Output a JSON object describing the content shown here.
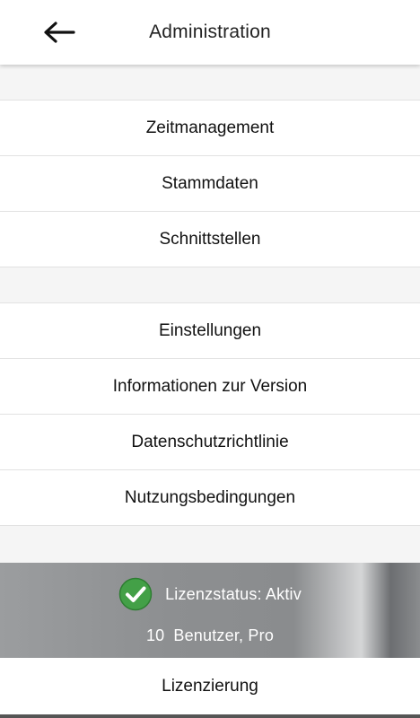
{
  "header": {
    "title": "Administration",
    "back_icon": "arrow-left-icon"
  },
  "menu_group_1": [
    {
      "label": "Zeitmanagement"
    },
    {
      "label": "Stammdaten"
    },
    {
      "label": "Schnittstellen"
    }
  ],
  "menu_group_2": [
    {
      "label": "Einstellungen"
    },
    {
      "label": "Informationen zur Version"
    },
    {
      "label": "Datenschutzrichtlinie"
    },
    {
      "label": "Nutzungsbedingungen"
    }
  ],
  "license": {
    "status_text": "Lizenzstatus: Aktiv",
    "status_icon": "check-circle-icon",
    "user_count": "10",
    "plan_text": "Benutzer, Pro",
    "status_color": "#43a047"
  },
  "license_button": {
    "label": "Lizenzierung"
  },
  "colors": {
    "background": "#f5f5f5",
    "card": "#ffffff",
    "divider": "#e2e2e2",
    "text": "#111111"
  }
}
